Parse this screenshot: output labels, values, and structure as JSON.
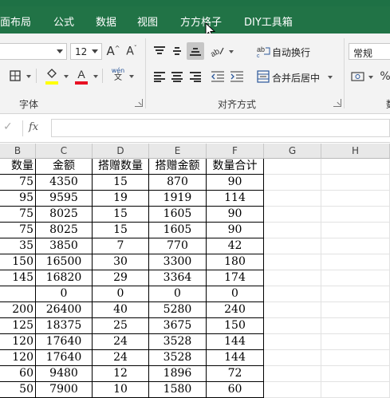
{
  "ribbon_tabs": [
    "面布局",
    "公式",
    "数据",
    "视图",
    "方方格子",
    "DIY工具箱"
  ],
  "font_group": {
    "label": "字体",
    "font_size": "12",
    "grow_font_icon": "A^",
    "shrink_font_icon": "Aˇ",
    "font_color_letter": "A",
    "font_color": "#e81123",
    "highlight_color": "#ffff00",
    "phonetic_top": "wén",
    "phonetic_bottom": "文"
  },
  "align_group": {
    "label": "对齐方式",
    "wrap_text": "自动换行",
    "merge_center": "合并后居中"
  },
  "number_group": {
    "format_value": "常规",
    "label_partial": "数"
  },
  "formula_bar": {
    "fx": "fx",
    "cancel": "✓",
    "value": ""
  },
  "columns": [
    "B",
    "C",
    "D",
    "E",
    "F",
    "G",
    "H"
  ],
  "headers": [
    "数量",
    "金额",
    "搭赠数量",
    "搭赠金额",
    "数量合计"
  ],
  "rows": [
    [
      "75",
      "4350",
      "15",
      "870",
      "90"
    ],
    [
      "95",
      "9595",
      "19",
      "1919",
      "114"
    ],
    [
      "75",
      "8025",
      "15",
      "1605",
      "90"
    ],
    [
      "75",
      "8025",
      "15",
      "1605",
      "90"
    ],
    [
      "35",
      "3850",
      "7",
      "770",
      "42"
    ],
    [
      "150",
      "16500",
      "30",
      "3300",
      "180"
    ],
    [
      "145",
      "16820",
      "29",
      "3364",
      "174"
    ],
    [
      "",
      "0",
      "0",
      "0",
      "0"
    ],
    [
      "200",
      "26400",
      "40",
      "5280",
      "240"
    ],
    [
      "125",
      "18375",
      "25",
      "3675",
      "150"
    ],
    [
      "120",
      "17640",
      "24",
      "3528",
      "144"
    ],
    [
      "120",
      "17640",
      "24",
      "3528",
      "144"
    ],
    [
      "60",
      "9480",
      "12",
      "1896",
      "72"
    ],
    [
      "50",
      "7900",
      "10",
      "1580",
      "60"
    ]
  ]
}
